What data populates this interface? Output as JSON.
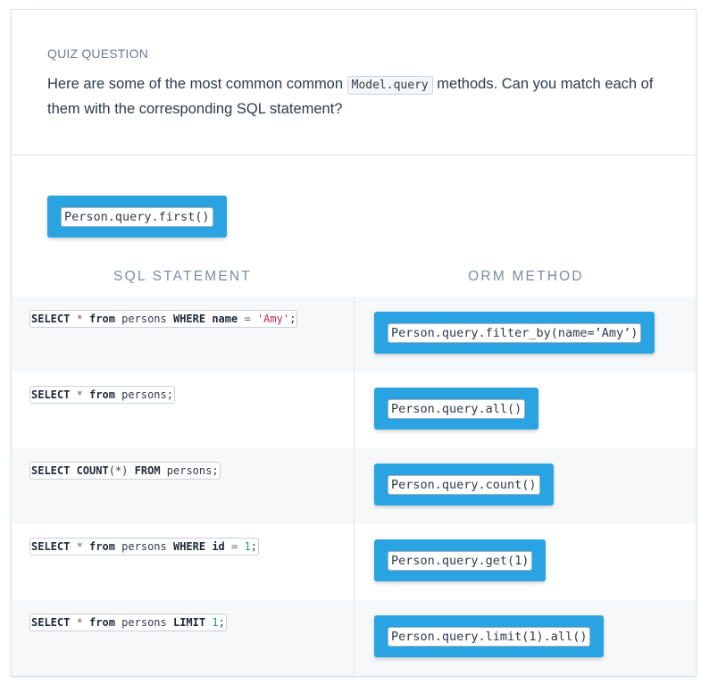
{
  "question": {
    "label": "QUIZ QUESTION",
    "text_before": "Here are some of the most common common ",
    "code": "Model.query",
    "text_after": " methods. Can you match each of them with the corresponding SQL statement?"
  },
  "unplaced_chip": {
    "label": "Person.query.first()"
  },
  "columns": {
    "sql": "SQL STATEMENT",
    "orm": "ORM METHOD"
  },
  "rows": [
    {
      "sql": {
        "kw1": "SELECT",
        "star": " * ",
        "kw2": "from",
        "table": " persons ",
        "kw3": "WHERE",
        "col": " name ",
        "op": "=",
        "sp": " ",
        "val": "'Amy'",
        "end": ";"
      },
      "orm": "Person.query.filter_by(name=’Amy’)"
    },
    {
      "sql": {
        "kw1": "SELECT",
        "star": " * ",
        "kw2": "from",
        "rest": " persons;"
      },
      "orm": "Person.query.all()"
    },
    {
      "sql": {
        "kw1": "SELECT",
        "fn": " COUNT",
        "args": "(*)",
        "sp": " ",
        "kw2": "FROM",
        "rest": " persons;"
      },
      "orm": "Person.query.count()"
    },
    {
      "sql": {
        "kw1": "SELECT",
        "star": " * ",
        "kw2": "from",
        "table": " persons ",
        "kw3": "WHERE",
        "col": " id ",
        "op": "=",
        "sp": " ",
        "val": "1",
        "end": ";"
      },
      "orm": "Person.query.get(1)"
    },
    {
      "sql": {
        "kw1": "SELECT",
        "star": " * ",
        "kw2": "from",
        "table": " persons ",
        "kw3": "LIMIT",
        "sp": " ",
        "val": "1",
        "end": ";"
      },
      "orm": "Person.query.limit(1).all()"
    }
  ],
  "colors": {
    "chip": "#2aa3e3",
    "string": "#c7254e",
    "number": "#1a9c8a",
    "muted": "#7b8ea3"
  }
}
